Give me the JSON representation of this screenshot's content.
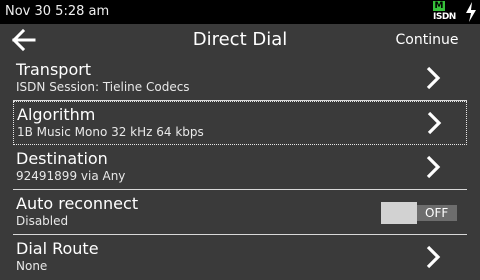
{
  "status": {
    "time": "Nov 30 5:28 am",
    "isdn_m": "M",
    "isdn_label": "ISDN",
    "isdn_color": "#36c23a",
    "power_icon": "bolt-icon"
  },
  "header": {
    "back_icon": "arrow-left-icon",
    "title": "Direct Dial",
    "continue_label": "Continue"
  },
  "rows": [
    {
      "title": "Transport",
      "subtitle": "ISDN Session: Tieline Codecs",
      "control": "chevron"
    },
    {
      "title": "Algorithm",
      "subtitle": "1B Music Mono 32 kHz 64 kbps",
      "control": "chevron",
      "focused": true
    },
    {
      "title": "Destination",
      "subtitle": "92491899 via Any",
      "control": "chevron"
    },
    {
      "title": "Auto reconnect",
      "subtitle": "Disabled",
      "control": "toggle",
      "toggle_label": "OFF",
      "toggle_on": false
    },
    {
      "title": "Dial Route",
      "subtitle": "None",
      "control": "chevron"
    }
  ],
  "colors": {
    "background": "#3a3a3a",
    "statusbar": "#000000",
    "divider": "#d8d8d8"
  }
}
